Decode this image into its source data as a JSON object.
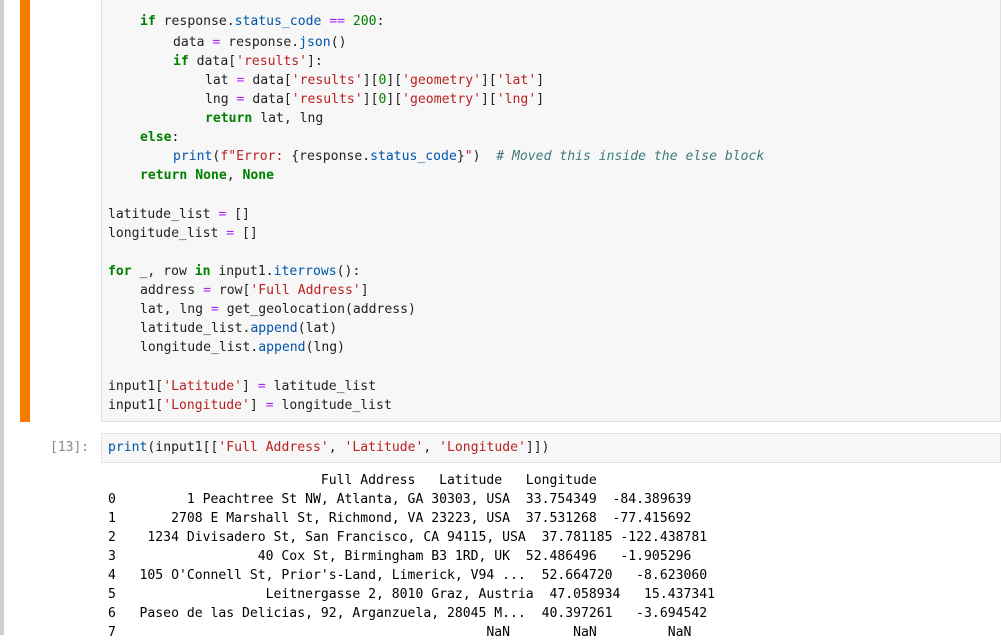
{
  "code": {
    "l1": "if response.status_code == 200:",
    "l2": "data = response.json()",
    "l3": "if data['results']:",
    "l4": "lat = data['results'][0]['geometry']['lat']",
    "l5": "lng = data['results'][0]['geometry']['lng']",
    "l6": "return lat, lng",
    "l7": "else:",
    "l8": "print(f\"Error: {response.status_code}\")",
    "l8c": "# Moved this inside the else block",
    "l9": "return None, None",
    "l10": "latitude_list = []",
    "l11": "longitude_list = []",
    "l12": "for _, row in input1.iterrows():",
    "l13": "address = row['Full Address']",
    "l14": "lat, lng = get_geolocation(address)",
    "l15": "latitude_list.append(lat)",
    "l16": "longitude_list.append(lng)",
    "l17": "input1['Latitude'] = latitude_list",
    "l18": "input1['Longitude'] = longitude_list"
  },
  "cell2": {
    "prompt": "[13]:",
    "code": "print(input1[['Full Address', 'Latitude', 'Longitude']])"
  },
  "output": {
    "header": "                           Full Address   Latitude   Longitude",
    "rows": [
      "0         1 Peachtree St NW, Atlanta, GA 30303, USA  33.754349  -84.389639",
      "1       2708 E Marshall St, Richmond, VA 23223, USA  37.531268  -77.415692",
      "2    1234 Divisadero St, San Francisco, CA 94115, USA  37.781185 -122.438781",
      "3                  40 Cox St, Birmingham B3 1RD, UK  52.486496   -1.905296",
      "4   105 O'Connell St, Prior's-Land, Limerick, V94 ...  52.664720   -8.623060",
      "5                   Leitnergasse 2, 8010 Graz, Austria  47.058934   15.437341",
      "6   Paseo de las Delicias, 92, Arganzuela, 28045 M...  40.397261   -3.694542",
      "7                                               NaN        NaN         NaN"
    ]
  }
}
